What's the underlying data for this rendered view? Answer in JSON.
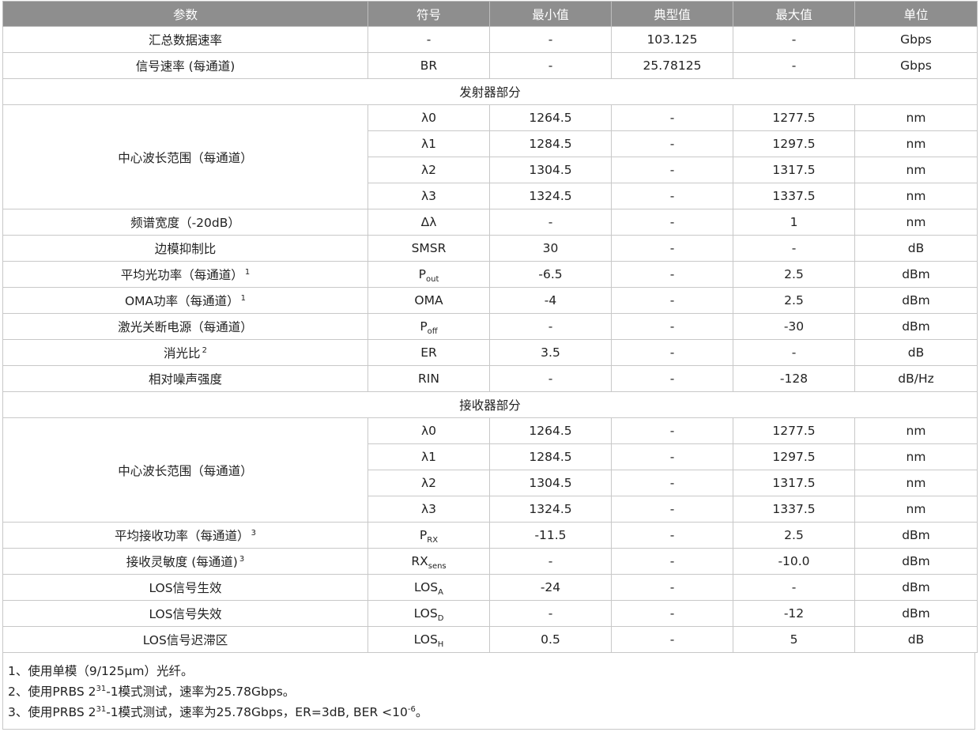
{
  "headers": [
    "参数",
    "符号",
    "最小值",
    "典型值",
    "最大值",
    "单位"
  ],
  "rows": [
    {
      "type": "data",
      "param": "汇总数据速率",
      "sym": "-",
      "min": "-",
      "typ": "103.125",
      "max": "-",
      "unit": "Gbps"
    },
    {
      "type": "data",
      "param": "信号速率 (每通道)",
      "sym": "BR",
      "min": "-",
      "typ": "25.78125",
      "max": "-",
      "unit": "Gbps"
    },
    {
      "type": "section",
      "label": "发射器部分"
    },
    {
      "type": "data",
      "param": "中心波长范围（每通道）",
      "rowspan": 4,
      "sym": "λ0",
      "min": "1264.5",
      "typ": "-",
      "max": "1277.5",
      "unit": "nm"
    },
    {
      "type": "data",
      "sym": "λ1",
      "min": "1284.5",
      "typ": "-",
      "max": "1297.5",
      "unit": "nm"
    },
    {
      "type": "data",
      "sym": "λ2",
      "min": "1304.5",
      "typ": "-",
      "max": "1317.5",
      "unit": "nm"
    },
    {
      "type": "data",
      "sym": "λ3",
      "min": "1324.5",
      "typ": "-",
      "max": "1337.5",
      "unit": "nm"
    },
    {
      "type": "data",
      "param": "频谱宽度（-20dB）",
      "sym": "Δλ",
      "min": "-",
      "typ": "-",
      "max": "1",
      "unit": "nm"
    },
    {
      "type": "data",
      "param": "边模抑制比",
      "sym": "SMSR",
      "min": "30",
      "typ": "-",
      "max": "-",
      "unit": "dB"
    },
    {
      "type": "data",
      "param": "平均光功率（每通道）",
      "param_sup": "1",
      "sym": "P",
      "sym_sub": "out",
      "min": "-6.5",
      "typ": "-",
      "max": "2.5",
      "unit": "dBm"
    },
    {
      "type": "data",
      "param": "OMA功率（每通道）",
      "param_sup": "1",
      "sym": "OMA",
      "min": "-4",
      "typ": "-",
      "max": "2.5",
      "unit": "dBm"
    },
    {
      "type": "data",
      "param": "激光关断电源（每通道）",
      "sym": "P",
      "sym_sub": "off",
      "min": "-",
      "typ": "-",
      "max": "-30",
      "unit": "dBm"
    },
    {
      "type": "data",
      "param": "消光比",
      "param_sup": "2",
      "sym": "ER",
      "min": "3.5",
      "typ": "-",
      "max": "-",
      "unit": "dB"
    },
    {
      "type": "data",
      "param": "相对噪声强度",
      "sym": "RIN",
      "min": "-",
      "typ": "-",
      "max": "-128",
      "unit": "dB/Hz"
    },
    {
      "type": "section",
      "label": "接收器部分"
    },
    {
      "type": "data",
      "param": "中心波长范围（每通道）",
      "rowspan": 4,
      "sym": "λ0",
      "min": "1264.5",
      "typ": "-",
      "max": "1277.5",
      "unit": "nm"
    },
    {
      "type": "data",
      "sym": "λ1",
      "min": "1284.5",
      "typ": "-",
      "max": "1297.5",
      "unit": "nm"
    },
    {
      "type": "data",
      "sym": "λ2",
      "min": "1304.5",
      "typ": "-",
      "max": "1317.5",
      "unit": "nm"
    },
    {
      "type": "data",
      "sym": "λ3",
      "min": "1324.5",
      "typ": "-",
      "max": "1337.5",
      "unit": "nm"
    },
    {
      "type": "data",
      "param": "平均接收功率（每通道）",
      "param_sup": "3",
      "sym": "P",
      "sym_sub": "RX",
      "min": "-11.5",
      "typ": "-",
      "max": "2.5",
      "unit": "dBm"
    },
    {
      "type": "data",
      "param": "接收灵敏度 (每通道)",
      "param_sup": "3",
      "sym": "RX",
      "sym_sub": "sens",
      "min": "-",
      "typ": "-",
      "max": "-10.0",
      "unit": "dBm"
    },
    {
      "type": "data",
      "param": "LOS信号生效",
      "sym": "LOS",
      "sym_sub": "A",
      "min": "-24",
      "typ": "-",
      "max": "-",
      "unit": "dBm"
    },
    {
      "type": "data",
      "param": "LOS信号失效",
      "sym": "LOS",
      "sym_sub": "D",
      "min": "-",
      "typ": "-",
      "max": "-12",
      "unit": "dBm"
    },
    {
      "type": "data",
      "param": "LOS信号迟滞区",
      "sym": "LOS",
      "sym_sub": "H",
      "min": "0.5",
      "typ": "-",
      "max": "5",
      "unit": "dB"
    }
  ],
  "notes": [
    {
      "text": "1、使用单模（9/125μm）光纤。"
    },
    {
      "pre": "2、使用PRBS 2",
      "sup": "31",
      "post": "-1模式测试，速率为25.78Gbps。"
    },
    {
      "pre": "3、使用PRBS 2",
      "sup": "31",
      "post": "-1模式测试，速率为25.78Gbps，ER=3dB, BER <10",
      "sup2": "-6",
      "post2": "。"
    }
  ]
}
